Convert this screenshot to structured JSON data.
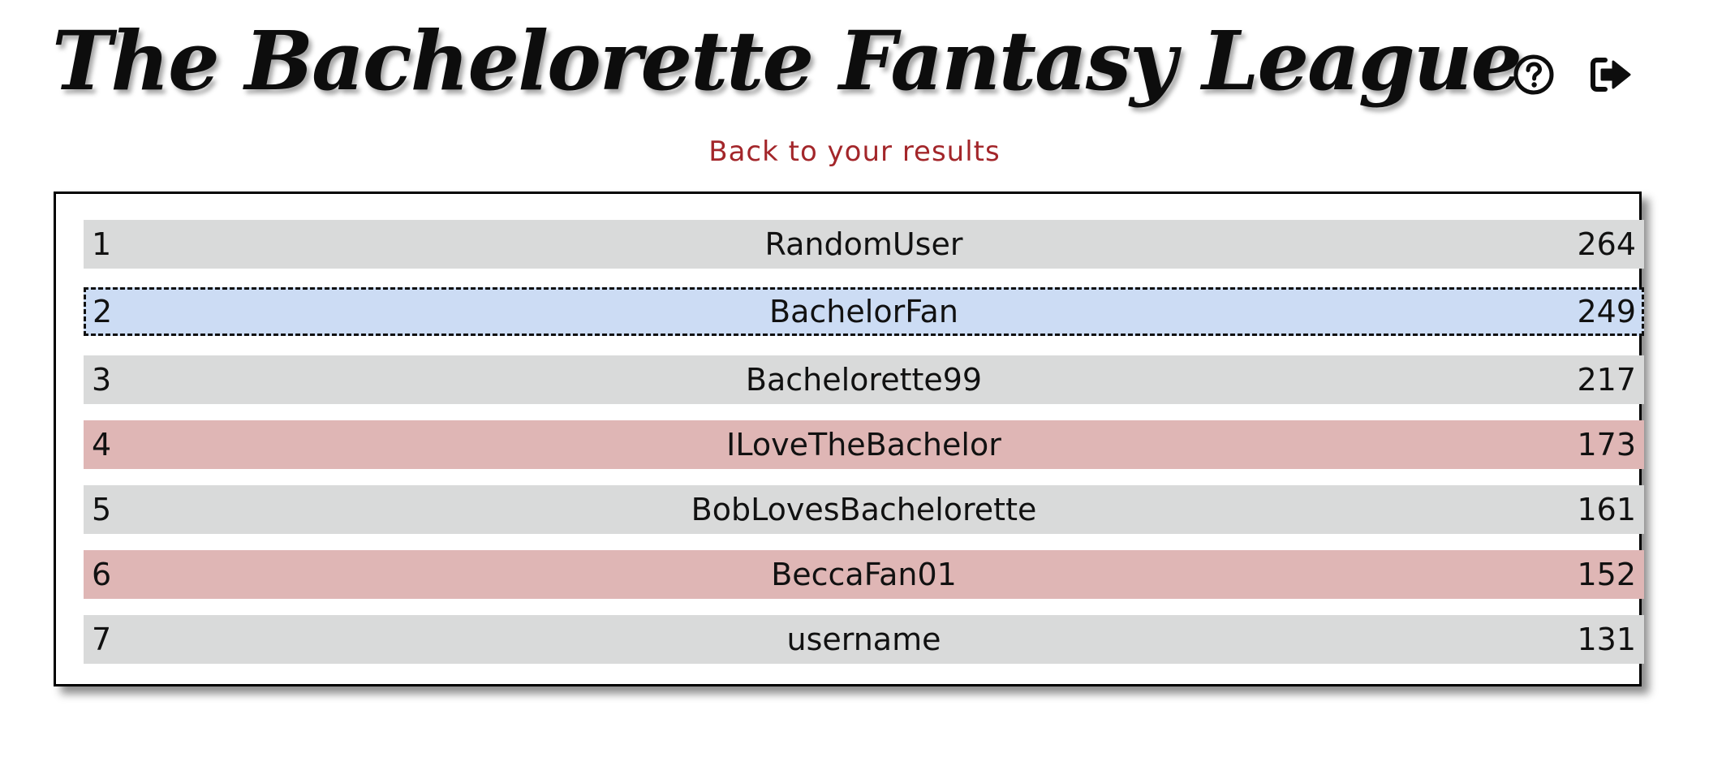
{
  "header": {
    "title": "The Bachelorette Fantasy League",
    "help_icon": "question-circle-icon",
    "logout_icon": "sign-out-icon"
  },
  "nav": {
    "back_link": "Back to your results"
  },
  "colors": {
    "link": "#a3262a",
    "row_neutral": "#d9dada",
    "row_highlight_current_user": "#ccdcf4",
    "row_highlight_red": "#dfb6b5"
  },
  "leaderboard": {
    "rows": [
      {
        "rank": "1",
        "name": "RandomUser",
        "score": "264",
        "style": "neutral"
      },
      {
        "rank": "2",
        "name": "BachelorFan",
        "score": "249",
        "style": "current"
      },
      {
        "rank": "3",
        "name": "Bachelorette99",
        "score": "217",
        "style": "neutral"
      },
      {
        "rank": "4",
        "name": "ILoveTheBachelor",
        "score": "173",
        "style": "red"
      },
      {
        "rank": "5",
        "name": "BobLovesBachelorette",
        "score": "161",
        "style": "neutral"
      },
      {
        "rank": "6",
        "name": "BeccaFan01",
        "score": "152",
        "style": "red"
      },
      {
        "rank": "7",
        "name": "username",
        "score": "131",
        "style": "neutral"
      }
    ]
  }
}
